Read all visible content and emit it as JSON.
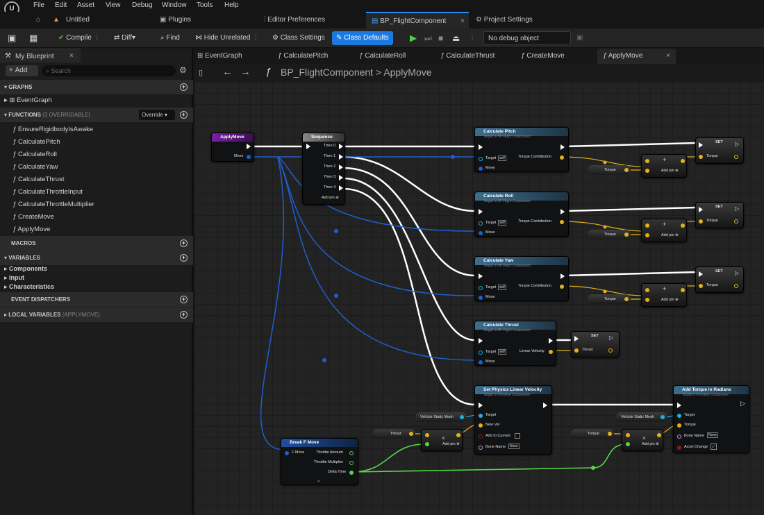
{
  "menu": {
    "items": [
      "File",
      "Edit",
      "Asset",
      "View",
      "Debug",
      "Window",
      "Tools",
      "Help"
    ]
  },
  "doc_tabs": {
    "project": "Untitled",
    "tabs": [
      "Plugins",
      "Editor Preferences",
      "BP_FlightComponent",
      "Project Settings"
    ]
  },
  "toolbar": {
    "compile": "Compile",
    "diff": "Diff",
    "find": "Find",
    "hide_unrelated": "Hide Unrelated",
    "class_settings": "Class Settings",
    "class_defaults": "Class Defaults",
    "debug_object": "No debug object selected"
  },
  "left_panel": {
    "tab_title": "My Blueprint",
    "add_label": "Add",
    "search_placeholder": "Search",
    "graphs_header": "GRAPHS",
    "event_graph": "EventGraph",
    "functions_header": "FUNCTIONS",
    "functions_overridable": "(3 OVERRIDABLE)",
    "override_label": "Override",
    "functions": [
      "EnsureRigidbodyIsAwake",
      "CalculatePitch",
      "CalculateRoll",
      "CalculateYaw",
      "CalculateThrust",
      "CalculateThrottleInput",
      "CalculateThrottleMultiplier",
      "CreateMove",
      "ApplyMove"
    ],
    "macros_header": "MACROS",
    "variables_header": "VARIABLES",
    "variable_categories": [
      "Components",
      "Input",
      "Characteristics"
    ],
    "dispatchers_header": "EVENT DISPATCHERS",
    "local_vars_header": "LOCAL VARIABLES",
    "local_vars_context": "(APPLYMOVE)"
  },
  "graph_tabs": [
    "EventGraph",
    "CalculatePitch",
    "CalculateRoll",
    "CalculateThrust",
    "CreateMove",
    "ApplyMove"
  ],
  "breadcrumb": {
    "component": "BP_FlightComponent",
    "function": "ApplyMove",
    "separator": ">"
  },
  "nodes": {
    "entry": {
      "title": "ApplyMove",
      "pin": "Move"
    },
    "sequence": {
      "title": "Sequence",
      "pins": [
        "Then 0",
        "Then 1",
        "Then 2",
        "Then 3",
        "Then 4"
      ],
      "add_pin": "Add pin"
    },
    "calc_pitch": {
      "title": "Calculate Pitch",
      "subtitle": "Target is BP Flight Component",
      "target": "Target",
      "self": "self",
      "move": "Move",
      "out": "Torque Contribution"
    },
    "calc_roll": {
      "title": "Calculate Roll",
      "subtitle": "Target is BP Flight Component",
      "target": "Target",
      "self": "self",
      "move": "Move",
      "out": "Torque Contribution"
    },
    "calc_yaw": {
      "title": "Calculate Yaw",
      "subtitle": "Target is BP Flight Component",
      "target": "Target",
      "self": "self",
      "move": "Move",
      "out": "Torque Contribution"
    },
    "calc_thrust": {
      "title": "Calculate Thrust",
      "subtitle": "Target is BP Flight Component",
      "target": "Target",
      "self": "self",
      "move": "Move",
      "out": "Linear Velocity"
    },
    "set_label": "SET",
    "torque": "Torque",
    "thrust": "Thrust",
    "add_pin": "Add pin",
    "set_phys": {
      "title": "Set Physics Linear Velocity",
      "subtitle": "Target is Primitive Component",
      "target": "Target",
      "new_vel": "New Vel",
      "add_to_current": "Add to Current",
      "bone_name": "Bone Name",
      "none": "None"
    },
    "vehicle_mesh": "Vehicle Static Mesh",
    "add_torque": {
      "title": "Add Torque in Radians",
      "subtitle": "Target is Primitive Component",
      "target": "Target",
      "torque": "Torque",
      "bone_name": "Bone Name",
      "none": "None",
      "accel_change": "Accel Change"
    },
    "break_move": {
      "title": "Break F Move",
      "in": "F Move",
      "outs": [
        "Throttle Amount",
        "Throttle Multiplier",
        "Delta Time"
      ]
    }
  },
  "colors": {
    "accent_blue": "#1b79e0",
    "exec": "#ffffff",
    "struct": "#1f5fd0",
    "float": "#e3b21a",
    "object": "#1cb1e8",
    "bool": "#8b1a1a",
    "name": "#c98ef0",
    "delta": "#56d64b"
  }
}
